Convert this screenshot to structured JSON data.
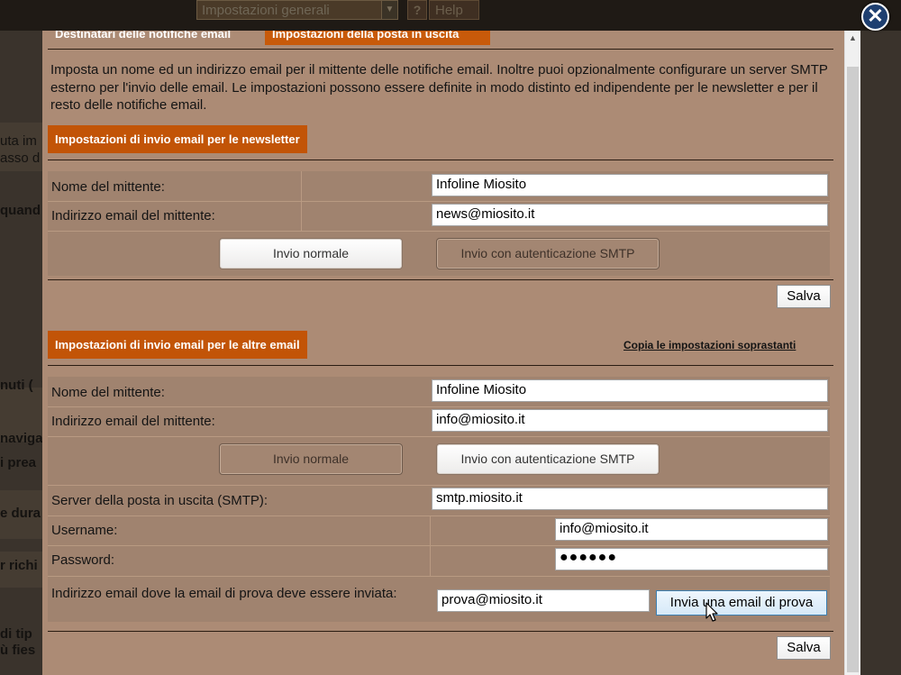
{
  "background": {
    "select_value": "Impostazioni generali",
    "help_icon": "?",
    "help_label": "Help",
    "fragments": [
      "uta im",
      "asso d",
      "quand",
      "nuti (",
      "naviga",
      "i prea",
      "e dura",
      "r richi",
      "di tip",
      "ù fies"
    ]
  },
  "tabs": {
    "tab1": "Destinatari delle notifiche email",
    "tab2": "Impostazioni della posta in uscita"
  },
  "intro_text": "Imposta un nome ed un indirizzo email per il mittente delle notifiche email. Inoltre puoi opzionalmente configurare un server SMTP esterno per l'invio delle email. Le impostazioni possono essere definite in modo distinto ed indipendente per le newsletter e per il resto delle notifiche email.",
  "newsletter": {
    "header": "Impostazioni di invio email per le newsletter",
    "sender_name_label": "Nome del mittente:",
    "sender_name_value": "Infoline Miosito",
    "sender_email_label": "Indirizzo email del mittente:",
    "sender_email_value": "news@miosito.it",
    "normal_send": "Invio normale",
    "smtp_send": "Invio con autenticazione SMTP",
    "mode_selected": "normal",
    "save": "Salva"
  },
  "other": {
    "header": "Impostazioni di invio email per le altre email",
    "copy_link": "Copia le impostazioni soprastanti",
    "sender_name_label": "Nome del mittente:",
    "sender_name_value": "Infoline Miosito",
    "sender_email_label": "Indirizzo email del mittente:",
    "sender_email_value": "info@miosito.it",
    "normal_send": "Invio normale",
    "smtp_send": "Invio con autenticazione SMTP",
    "mode_selected": "smtp",
    "smtp_server_label": "Server della posta in uscita (SMTP):",
    "smtp_server_value": "smtp.miosito.it",
    "username_label": "Username:",
    "username_value": "info@miosito.it",
    "password_label": "Password:",
    "password_value": "●●●●●●",
    "test_email_label": "Indirizzo email dove la email di prova deve essere inviata:",
    "test_email_value": "prova@miosito.it",
    "test_button": "Invia una email di prova",
    "save": "Salva"
  },
  "close_icon_glyph": "✕",
  "colors": {
    "accent": "#c25407",
    "panel": "#ac8b75",
    "form": "#a0836f"
  }
}
